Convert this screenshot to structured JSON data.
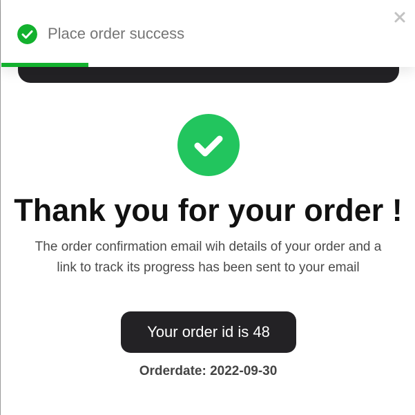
{
  "toast": {
    "message": "Place order success",
    "progress": 0.21,
    "icon": "check-circle-icon",
    "close_icon": "close-icon",
    "accent_color": "#13b12e"
  },
  "confirmation": {
    "icon": "check-circle-icon",
    "icon_color": "#22c55e",
    "title": "Thank you for your order !",
    "description": "The order confirmation email wih details of your order and a link to track its progress has been sent to your email",
    "order_id_text": "Your order id is 48",
    "order_date_text": "Orderdate: 2022-09-30"
  },
  "colors": {
    "dark": "#232225",
    "text": "#111111",
    "muted": "#4a4a4a"
  }
}
